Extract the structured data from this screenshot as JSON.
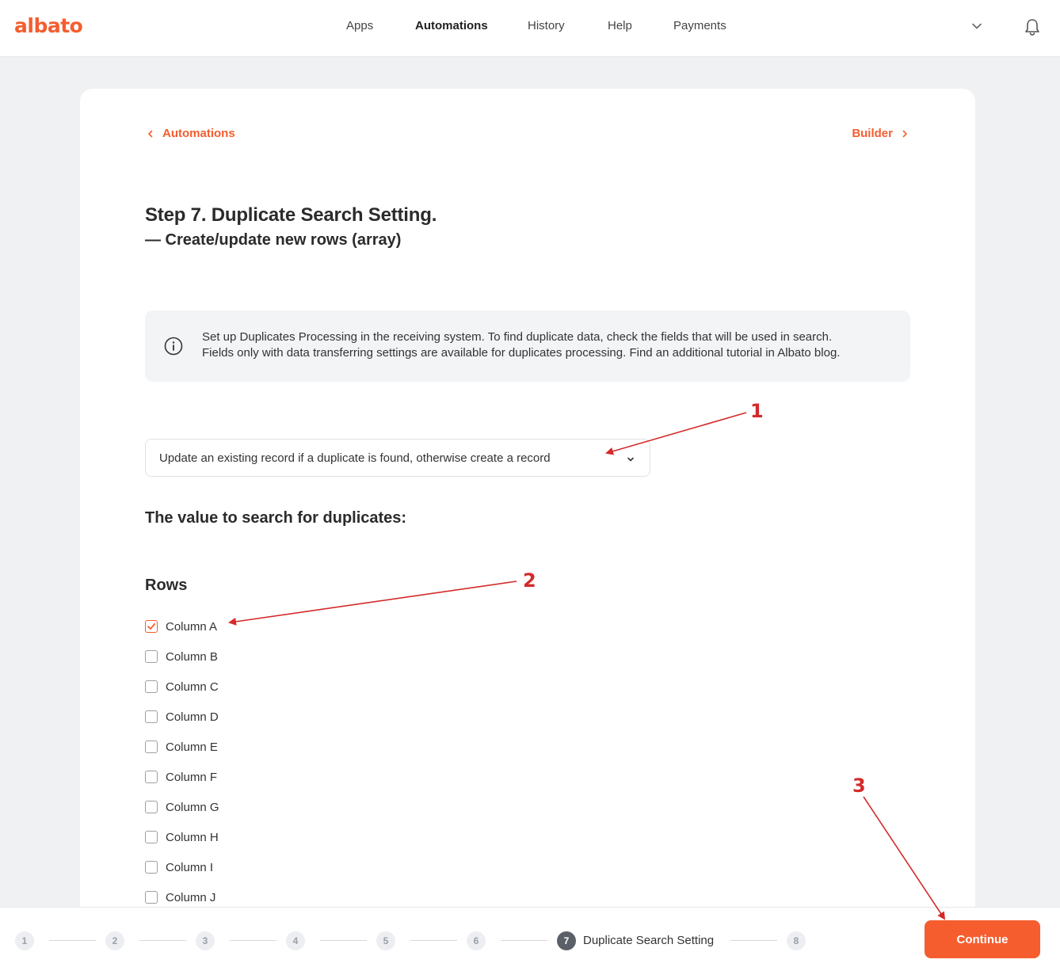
{
  "header": {
    "logo": "albato",
    "nav": [
      {
        "label": "Apps",
        "active": false
      },
      {
        "label": "Automations",
        "active": true
      },
      {
        "label": "History",
        "active": false
      },
      {
        "label": "Help",
        "active": false
      },
      {
        "label": "Payments",
        "active": false
      }
    ],
    "icons": {
      "dropdown": "chevron-down-icon",
      "notifications": "bell-icon"
    }
  },
  "breadcrumb": {
    "back_label": "Automations",
    "next_label": "Builder"
  },
  "page": {
    "title": "Step 7. Duplicate Search Setting.",
    "subtitle": "— Create/update new rows (array)"
  },
  "info": {
    "icon": "info-icon",
    "line1": "Set up Duplicates Processing in the receiving system. To find duplicate data, check the fields that will be used in search.",
    "line2": "Fields only with data transferring settings are available for duplicates processing. Find an additional tutorial in Albato blog."
  },
  "duplicate_mode": {
    "selected": "Update an existing record if a duplicate is found, otherwise create a record"
  },
  "search_heading": "The value to search for duplicates:",
  "rows": {
    "heading": "Rows",
    "columns": [
      {
        "label": "Column A",
        "checked": true
      },
      {
        "label": "Column B",
        "checked": false
      },
      {
        "label": "Column C",
        "checked": false
      },
      {
        "label": "Column D",
        "checked": false
      },
      {
        "label": "Column E",
        "checked": false
      },
      {
        "label": "Column F",
        "checked": false
      },
      {
        "label": "Column G",
        "checked": false
      },
      {
        "label": "Column H",
        "checked": false
      },
      {
        "label": "Column I",
        "checked": false
      },
      {
        "label": "Column J",
        "checked": false
      }
    ]
  },
  "stepper": {
    "steps": [
      "1",
      "2",
      "3",
      "4",
      "5",
      "6",
      "7",
      "8"
    ],
    "current_label": "Duplicate Search Setting",
    "current_index": 6
  },
  "continue_label": "Continue",
  "annotations": [
    "1",
    "2",
    "3"
  ],
  "colors": {
    "accent": "#f55d2f",
    "annotation": "#d42a2a",
    "background": "#f0f1f3"
  }
}
